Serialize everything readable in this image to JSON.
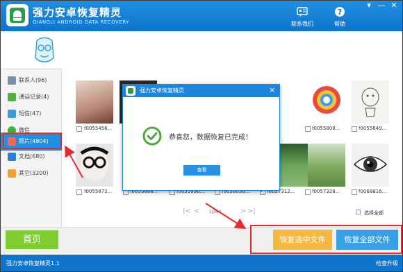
{
  "window": {
    "title": "强力安卓恢复精灵",
    "subtitle": "QIANGLI ANDROID DATA RECOVERY",
    "controls": {
      "menu": "▾",
      "minimize": "—",
      "close": "✕"
    }
  },
  "toolbar": {
    "contact_label": "联系我们",
    "help_label": "帮助"
  },
  "sidebar": {
    "items": [
      {
        "label": "联系人(96)",
        "icon": "contacts-icon",
        "color": "#7a8fa8"
      },
      {
        "label": "通话记录(4)",
        "icon": "phone-icon",
        "color": "#52b043"
      },
      {
        "label": "短信(47)",
        "icon": "sms-icon",
        "color": "#3a9be0"
      },
      {
        "label": "微信",
        "icon": "wechat-icon",
        "color": "#3fb63b"
      },
      {
        "label": "照片(4804)",
        "icon": "photo-icon",
        "color": "#f06a5a",
        "active": true
      },
      {
        "label": "文档(680)",
        "icon": "document-icon",
        "color": "#2f7fd6"
      },
      {
        "label": "其它(3200)",
        "icon": "other-icon",
        "color": "#f0a030"
      }
    ]
  },
  "photos": {
    "row1": [
      {
        "name": "f0055456...",
        "checked": false
      },
      {
        "name": "",
        "checked": false
      },
      {
        "name": "",
        "checked": false
      },
      {
        "name": "",
        "checked": false
      },
      {
        "name": "",
        "checked": false
      },
      {
        "name": "f0055808...",
        "checked": false
      },
      {
        "name": "f0055849...",
        "checked": false
      }
    ],
    "row2": [
      {
        "name": "f0055872...",
        "checked": false
      },
      {
        "name": "f0055888...",
        "checked": false
      },
      {
        "name": "f0055936...",
        "checked": false
      },
      {
        "name": "f0056056...",
        "checked": false
      },
      {
        "name": "f0057312...",
        "checked": true
      },
      {
        "name": "f0057328...",
        "checked": false
      },
      {
        "name": "f0068816...",
        "checked": false
      }
    ]
  },
  "pager": {
    "first": "|<",
    "prev": "<",
    "page": "1/344",
    "next": ">",
    "last": ">|",
    "select_all": "选择全部"
  },
  "bottom": {
    "home": "首页",
    "recover_selected": "恢复选中文件",
    "recover_all": "恢复全部文件"
  },
  "status": {
    "version": "强力安卓恢复精灵1.1",
    "upgrade": "检查升级"
  },
  "dialog": {
    "title": "强力安卓恢复精灵",
    "close": "×",
    "message": "恭喜您，数据恢复已完成！",
    "button": "查看"
  },
  "colors": {
    "brand_blue": "#1f8fe3",
    "highlight_red": "#e52b2b",
    "home_green": "#7fcd2e",
    "recover_orange": "#f7b840",
    "recover_blue": "#3aa0e6"
  }
}
